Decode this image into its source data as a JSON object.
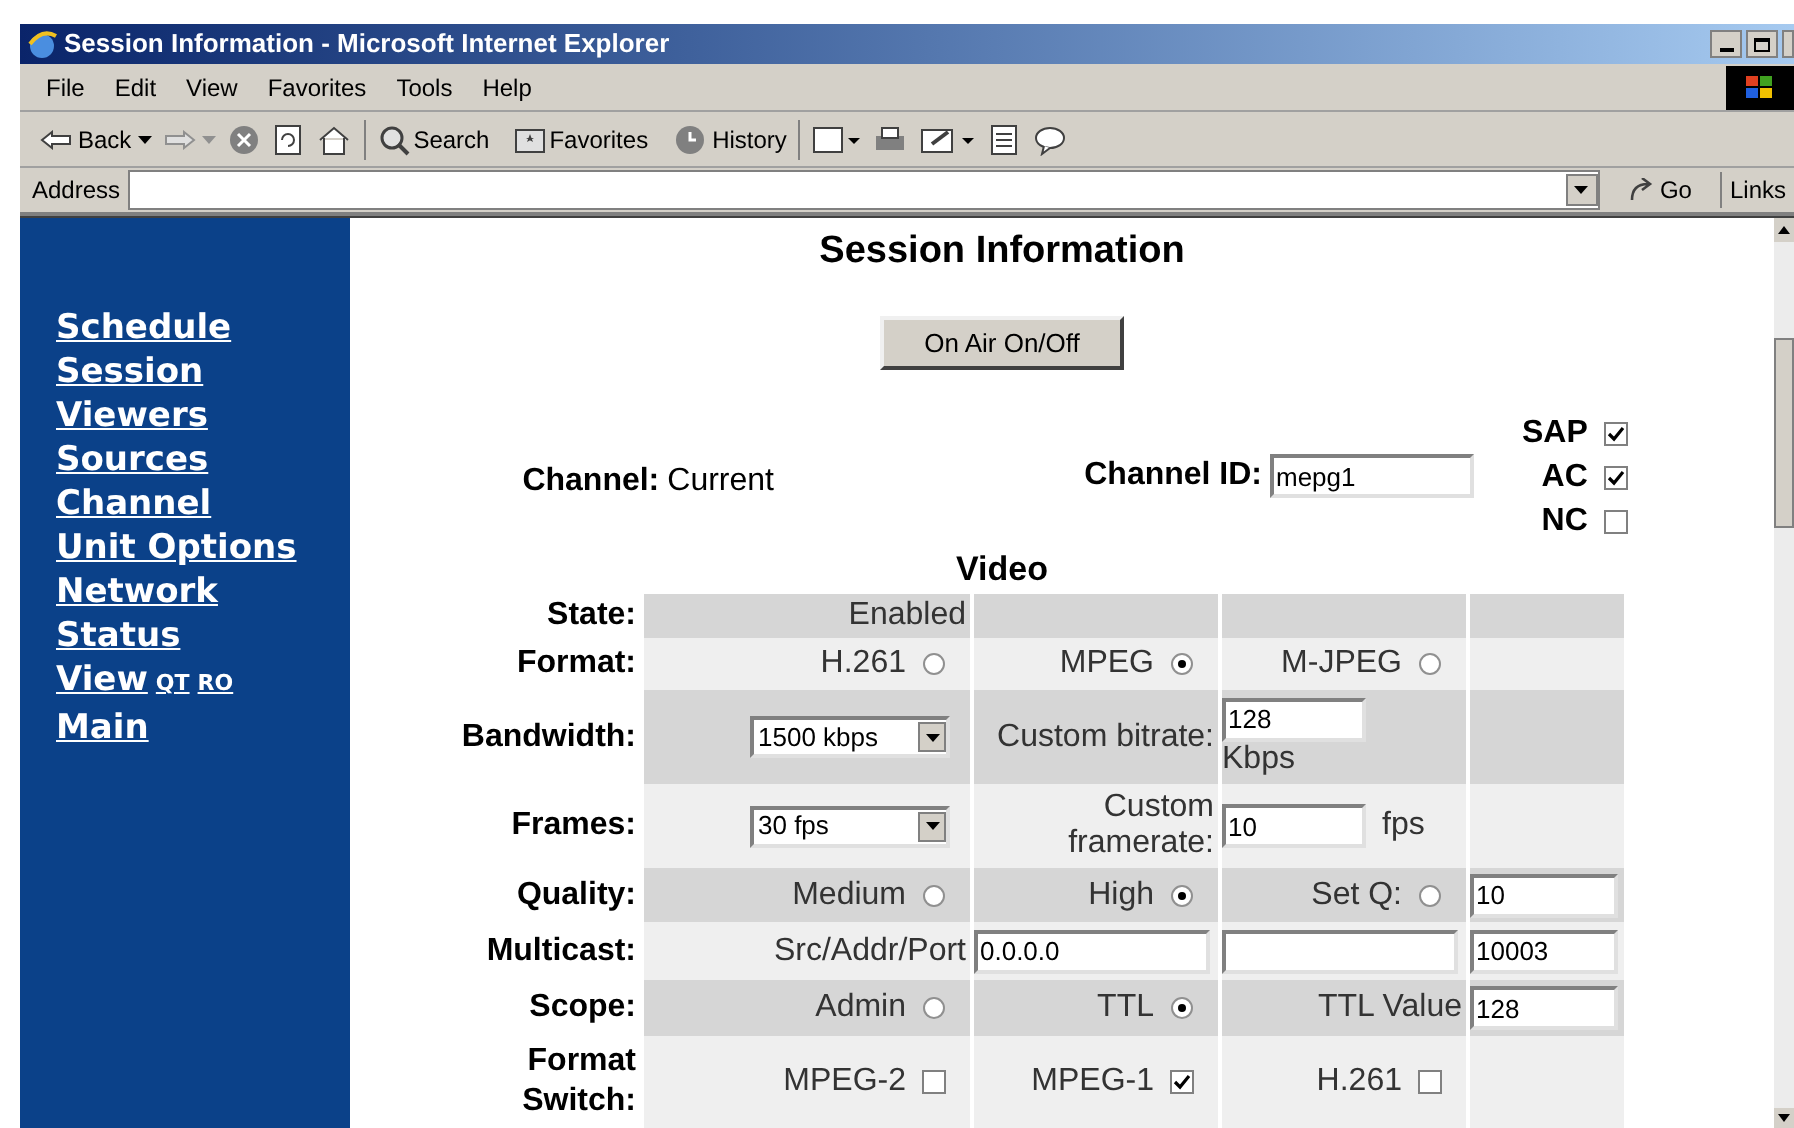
{
  "window": {
    "title": "Session Information - Microsoft Internet Explorer"
  },
  "menu": [
    "File",
    "Edit",
    "View",
    "Favorites",
    "Tools",
    "Help"
  ],
  "toolbar": {
    "back": "Back",
    "search": "Search",
    "favorites": "Favorites",
    "history": "History"
  },
  "address_bar": {
    "label": "Address",
    "go": "Go",
    "links": "Links"
  },
  "sidebar": {
    "items": [
      {
        "label": "Schedule"
      },
      {
        "label": "Session"
      },
      {
        "label": "Viewers"
      },
      {
        "label": "Sources"
      },
      {
        "label": "Channel"
      },
      {
        "label": "Unit Options"
      },
      {
        "label": "Network"
      },
      {
        "label": "Status"
      },
      {
        "label": "View",
        "sublinks": [
          "QT",
          "RO"
        ]
      },
      {
        "label": "Main"
      }
    ]
  },
  "page": {
    "title": "Session Information",
    "on_air_button": "On Air On/Off",
    "channel": {
      "label": "Channel:",
      "value": "Current"
    },
    "channel_id": {
      "label": "Channel ID:",
      "value": "mepg1"
    },
    "flags": [
      {
        "label": "SAP",
        "checked": true
      },
      {
        "label": "AC",
        "checked": true
      },
      {
        "label": "NC",
        "checked": false
      }
    ],
    "video": {
      "heading": "Video",
      "rows": [
        {
          "label": "State:",
          "cells": [
            {
              "kind": "text",
              "text": "Enabled"
            },
            {
              "kind": "empty"
            },
            {
              "kind": "empty"
            },
            {
              "kind": "empty"
            }
          ]
        },
        {
          "label": "Format:",
          "cells": [
            {
              "kind": "radio",
              "label": "H.261",
              "selected": false
            },
            {
              "kind": "radio",
              "label": "MPEG",
              "selected": true
            },
            {
              "kind": "radio",
              "label": "M-JPEG",
              "selected": false
            },
            {
              "kind": "empty"
            }
          ]
        },
        {
          "label": "Bandwidth:",
          "cells": [
            {
              "kind": "select",
              "value": "1500 kbps"
            },
            {
              "kind": "text",
              "text": "Custom bitrate:"
            },
            {
              "kind": "input_unit_below",
              "value": "128",
              "unit": "Kbps"
            },
            {
              "kind": "empty"
            }
          ]
        },
        {
          "label": "Frames:",
          "cells": [
            {
              "kind": "select",
              "value": "30 fps"
            },
            {
              "kind": "text",
              "text": "Custom framerate:"
            },
            {
              "kind": "input_unit_after",
              "value": "10",
              "unit": "fps"
            },
            {
              "kind": "empty"
            }
          ]
        },
        {
          "label": "Quality:",
          "cells": [
            {
              "kind": "radio",
              "label": "Medium",
              "selected": false
            },
            {
              "kind": "radio",
              "label": "High",
              "selected": true
            },
            {
              "kind": "radio",
              "label": "Set Q:",
              "selected": false
            },
            {
              "kind": "input",
              "value": "10"
            }
          ]
        },
        {
          "label": "Multicast:",
          "cells": [
            {
              "kind": "text",
              "text": "Src/Addr/Port"
            },
            {
              "kind": "input",
              "value": "0.0.0.0"
            },
            {
              "kind": "input"
            },
            {
              "kind": "input",
              "value": "10003"
            }
          ]
        },
        {
          "label": "Scope:",
          "cells": [
            {
              "kind": "radio",
              "label": "Admin",
              "selected": false
            },
            {
              "kind": "radio",
              "label": "TTL",
              "selected": true
            },
            {
              "kind": "text",
              "text": "TTL Value"
            },
            {
              "kind": "input",
              "value": "128"
            }
          ]
        },
        {
          "label": "Format Switch:",
          "cells": [
            {
              "kind": "checkbox",
              "label": "MPEG-2",
              "checked": false
            },
            {
              "kind": "checkbox",
              "label": "MPEG-1",
              "checked": true
            },
            {
              "kind": "checkbox",
              "label": "H.261",
              "checked": false
            },
            {
              "kind": "empty"
            }
          ]
        }
      ]
    }
  }
}
